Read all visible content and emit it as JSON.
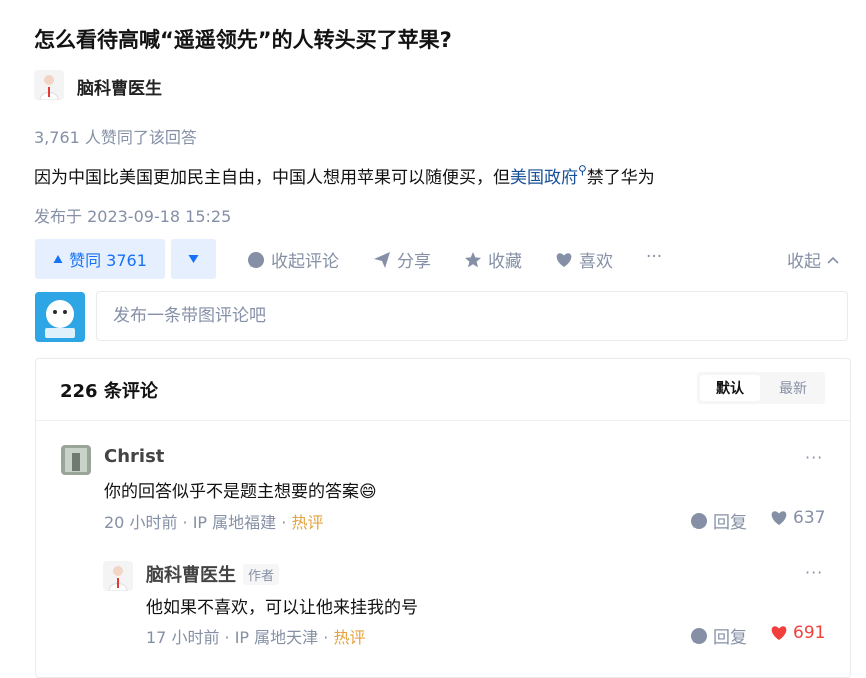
{
  "question": {
    "title": "怎么看待高喊“遥遥领先”的人转头买了苹果?"
  },
  "answer": {
    "author": "脑科曹医生",
    "votes_text": "3,761 人赞同了该回答",
    "content_before": "因为中国比美国更加民主自由，中国人想用苹果可以随便买，但",
    "content_link": "美国政府",
    "content_after": "禁了华为",
    "published": "发布于 2023-09-18 15:25"
  },
  "actions": {
    "upvote": "赞同 3761",
    "collapse_comments": "收起评论",
    "share": "分享",
    "favorite": "收藏",
    "like": "喜欢",
    "more": "···",
    "collapse": "收起"
  },
  "comment_input": {
    "placeholder": "发布一条带图评论吧"
  },
  "comments": {
    "count_label": "226 条评论",
    "sort_default": "默认",
    "sort_latest": "最新",
    "items": [
      {
        "name": "Christ",
        "text": "你的回答似乎不是题主想要的答案",
        "emoji": "😄",
        "meta": "20 小时前 · IP 属地福建 ·",
        "hot": "热评",
        "reply": "回复",
        "likes": "637"
      },
      {
        "name": "脑科曹医生",
        "author_tag": "作者",
        "text": "他如果不喜欢，可以让他来挂我的号",
        "meta": "17 小时前 · IP 属地天津 ·",
        "hot": "热评",
        "reply": "回复",
        "likes": "691"
      }
    ]
  },
  "colors": {
    "accent": "#1772f6",
    "muted": "#8590a6",
    "hot": "#e6a23c",
    "liked": "#f1403c"
  },
  "icons": [
    "doctor-avatar",
    "triangle-up-icon",
    "triangle-down-icon",
    "comment-bubble-icon",
    "share-plane-icon",
    "star-icon",
    "heart-icon",
    "chevron-up-icon",
    "search-icon",
    "more-dots-icon"
  ]
}
